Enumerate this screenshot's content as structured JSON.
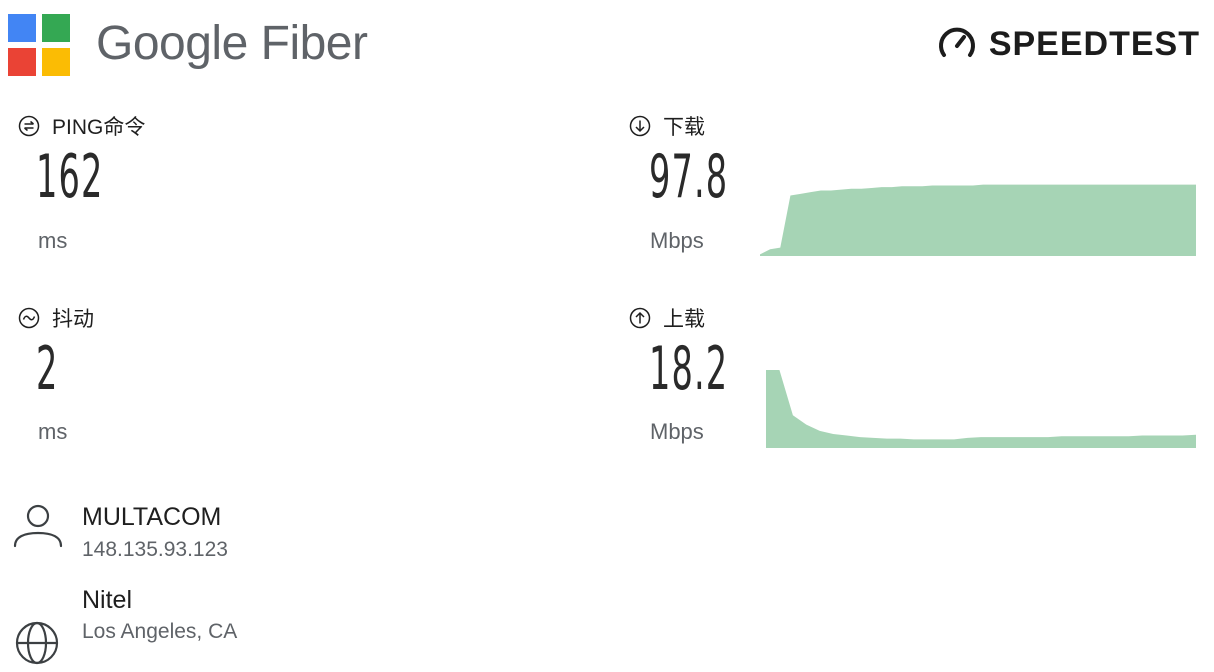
{
  "brand": {
    "name": "Google Fiber",
    "logo_icon": "google-fiber-logo-icon",
    "colors": [
      "#4285F4",
      "#34A853",
      "#EA4335",
      "#FBBC04"
    ]
  },
  "speedtest": {
    "label": "SPEEDTEST",
    "icon": "speedometer-icon"
  },
  "ping": {
    "label": "PING命令",
    "value": "162",
    "unit": "ms",
    "icon": "ping-icon"
  },
  "jitter": {
    "label": "抖动",
    "value": "2",
    "unit": "ms",
    "icon": "jitter-icon"
  },
  "download": {
    "label": "下载",
    "value": "97.8",
    "unit": "Mbps",
    "icon": "download-arrow-icon"
  },
  "upload": {
    "label": "上载",
    "value": "18.2",
    "unit": "Mbps",
    "icon": "upload-arrow-icon"
  },
  "isp": {
    "name": "MULTACOM",
    "ip": "148.135.93.123",
    "icon": "user-icon"
  },
  "server": {
    "name": "Nitel",
    "location": "Los Angeles, CA",
    "icon": "globe-icon"
  },
  "colors": {
    "chart_fill": "#a6d4b5",
    "text_primary": "#1f1f1f",
    "text_secondary": "#5f6368"
  },
  "chart_data": [
    {
      "type": "area",
      "series": [
        {
          "values": [
            2,
            8,
            10,
            72,
            74,
            76,
            78,
            78,
            79,
            80,
            80,
            81,
            82,
            82,
            83,
            83,
            83,
            84,
            84,
            84,
            84,
            84,
            85,
            85,
            85,
            85,
            85,
            85,
            85,
            85,
            85,
            85,
            85,
            85,
            85,
            85,
            85,
            85,
            85,
            85,
            85,
            85,
            85,
            85
          ]
        }
      ],
      "ylim": [
        0,
        100
      ]
    },
    {
      "type": "area",
      "series": [
        {
          "values": [
            100,
            100,
            42,
            30,
            22,
            18,
            16,
            14,
            13,
            12,
            12,
            11,
            11,
            11,
            11,
            13,
            14,
            14,
            14,
            14,
            14,
            14,
            15,
            15,
            15,
            15,
            15,
            15,
            16,
            16,
            16,
            16,
            17
          ]
        }
      ],
      "ylim": [
        0,
        100
      ]
    }
  ]
}
